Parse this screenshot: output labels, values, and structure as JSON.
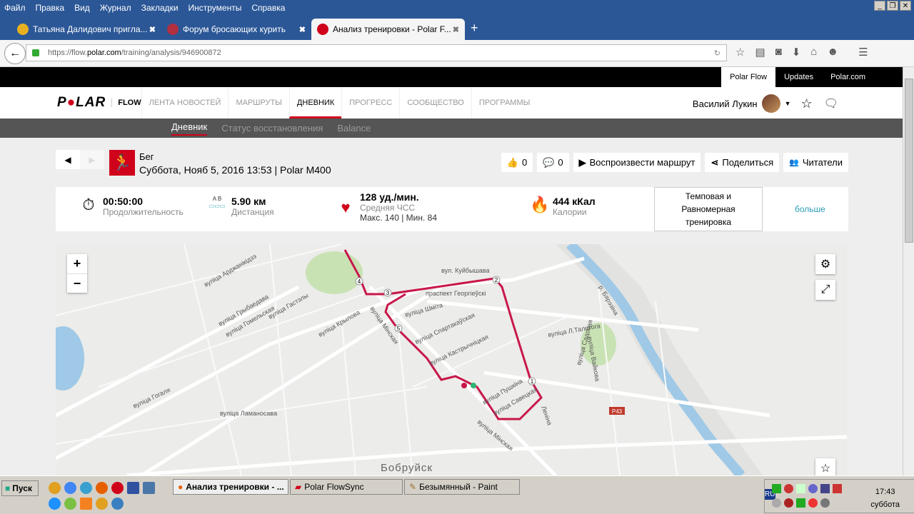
{
  "browser": {
    "menu": [
      "Файл",
      "Правка",
      "Вид",
      "Журнал",
      "Закладки",
      "Инструменты",
      "Справка"
    ],
    "tabs": [
      {
        "title": "Татьяна Далидович пригла...",
        "color": "#e8b020"
      },
      {
        "title": "Форум бросающих курить",
        "color": "#b03040"
      },
      {
        "title": "Анализ тренировки - Polar F...",
        "color": "#d0021b",
        "active": true
      }
    ],
    "url_prefix": "https://flow.",
    "url_host": "polar.com",
    "url_path": "/training/analysis/946900872"
  },
  "site": {
    "toplinks": [
      "Polar Flow",
      "Updates",
      "Polar.com"
    ],
    "logo": "POLAR",
    "flow": "FLOW",
    "nav": [
      "ЛЕНТА НОВОСТЕЙ",
      "МАРШРУТЫ",
      "ДНЕВНИК",
      "ПРОГРЕСС",
      "СООБЩЕСТВО",
      "ПРОГРАММЫ"
    ],
    "user": "Василий Лукин",
    "subnav": [
      "Дневник",
      "Статус восстановления",
      "Balance"
    ]
  },
  "training": {
    "sport": "Бег",
    "subtitle": "Суббота, Нояб 5, 2016 13:53 | Polar M400",
    "likes": "0",
    "comments": "0",
    "replay": "Воспроизвести маршрут",
    "share": "Поделиться",
    "readers": "Читатели"
  },
  "summary": {
    "duration": "00:50:00",
    "duration_label": "Продолжительность",
    "distance": "5.90 км",
    "distance_label": "Дистанция",
    "ab": "A  B",
    "hr": "128 уд./мин.",
    "hr_label": "Средняя ЧСС",
    "hr_minmax": "Макс. 140  |  Мин. 84",
    "calories": "444 кКал",
    "calories_label": "Калории",
    "benefit": "Темповая и Равномерная тренировка",
    "more": "больше"
  },
  "map": {
    "city": "Бобруйск",
    "river": "р. Бярэзіна",
    "road": "P43",
    "streets": [
      "вул. Куйбышава",
      "праспект Георгіеўскі",
      "вуліца Шміта",
      "вуліца Спартакаўская",
      "вуліца Кастрычніцкая",
      "вуліца Пушкіна",
      "вуліца Савецкая",
      "вуліца Мінская",
      "вуліца Л.Талстога",
      "вуліца Вайкова",
      "вуліца Садовая",
      "Леніна",
      "вуліца Крылова",
      "вуліца Гомельская",
      "вуліца Грыбаедава",
      "вуліца Гастэлы",
      "вуліца Арджанікідзэ",
      "вуліца Гогаля",
      "вуліца Ламаносава",
      "вуліца Мінская"
    ],
    "markers": [
      "1",
      "2",
      "3",
      "4",
      "5"
    ]
  },
  "taskbar": {
    "start": "Пуск",
    "tasks": [
      "Анализ тренировки - ...",
      "Polar FlowSync",
      "Безымянный - Paint"
    ],
    "lang": "RU",
    "time": "17:43",
    "day": "суббота"
  }
}
